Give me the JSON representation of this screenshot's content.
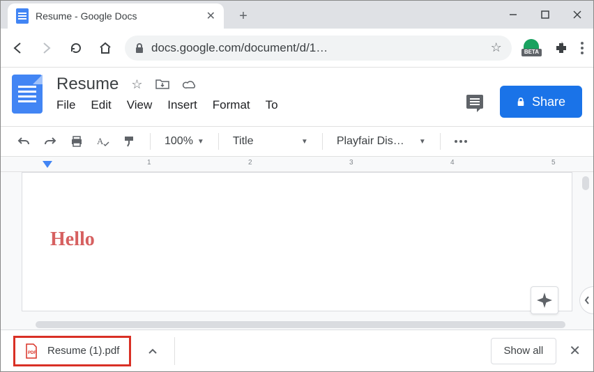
{
  "browser": {
    "tab_title": "Resume - Google Docs",
    "url": "docs.google.com/document/d/1…",
    "beta_label": "BETA"
  },
  "docs": {
    "title": "Resume",
    "menus": [
      "File",
      "Edit",
      "View",
      "Insert",
      "Format",
      "To"
    ],
    "share_label": "Share"
  },
  "toolbar": {
    "zoom": "100%",
    "style": "Title",
    "font": "Playfair Dis…"
  },
  "ruler": {
    "marks": [
      "1",
      "2",
      "3",
      "4",
      "5"
    ]
  },
  "document": {
    "heading": "Hello"
  },
  "downloads": {
    "file_name": "Resume (1).pdf",
    "show_all_label": "Show all"
  }
}
